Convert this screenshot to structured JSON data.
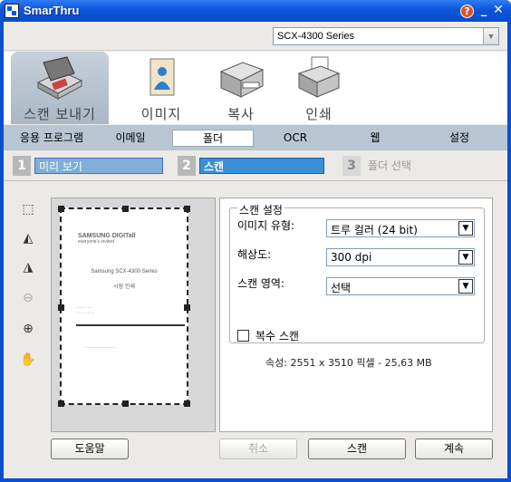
{
  "window": {
    "title": "SmarThru"
  },
  "model": {
    "value": "SCX-4300 Series"
  },
  "modes": [
    {
      "label": "스캔 보내기",
      "icon": "scanner-icon",
      "active": true
    },
    {
      "label": "이미지",
      "icon": "image-icon",
      "active": false
    },
    {
      "label": "복사",
      "icon": "copier-icon",
      "active": false
    },
    {
      "label": "인쇄",
      "icon": "printer-icon",
      "active": false
    }
  ],
  "subtabs": [
    {
      "label": "응용 프로그램"
    },
    {
      "label": "이메일"
    },
    {
      "label": "폴더",
      "active": true
    },
    {
      "label": "OCR"
    },
    {
      "label": "웹"
    },
    {
      "label": "설정"
    }
  ],
  "steps": [
    {
      "num": "1",
      "label": "미리 보기"
    },
    {
      "num": "2",
      "label": "스캔"
    },
    {
      "num": "3",
      "label": "폴더 선택"
    }
  ],
  "preview_doc": {
    "logo": "SAMSUNG DIGITall",
    "logo_sub": "everyone's invited",
    "title": "Samsung SCX-4300 Series",
    "subtitle": "시험 인쇄"
  },
  "scan_settings": {
    "legend": "스캔 설정",
    "image_type_label": "이미지 유형:",
    "image_type_value": "트루 컬러 (24 bit)",
    "resolution_label": "해상도:",
    "resolution_value": "300 dpi",
    "area_label": "스캔 영역:",
    "area_value": "선택",
    "multi_scan_label": "복수 스캔",
    "multi_scan_checked": false,
    "properties": "속성: 2551 x 3510 픽셀 - 25,63 MB"
  },
  "buttons": {
    "help": "도움말",
    "cancel": "취소",
    "scan": "스캔",
    "continue": "계속"
  }
}
